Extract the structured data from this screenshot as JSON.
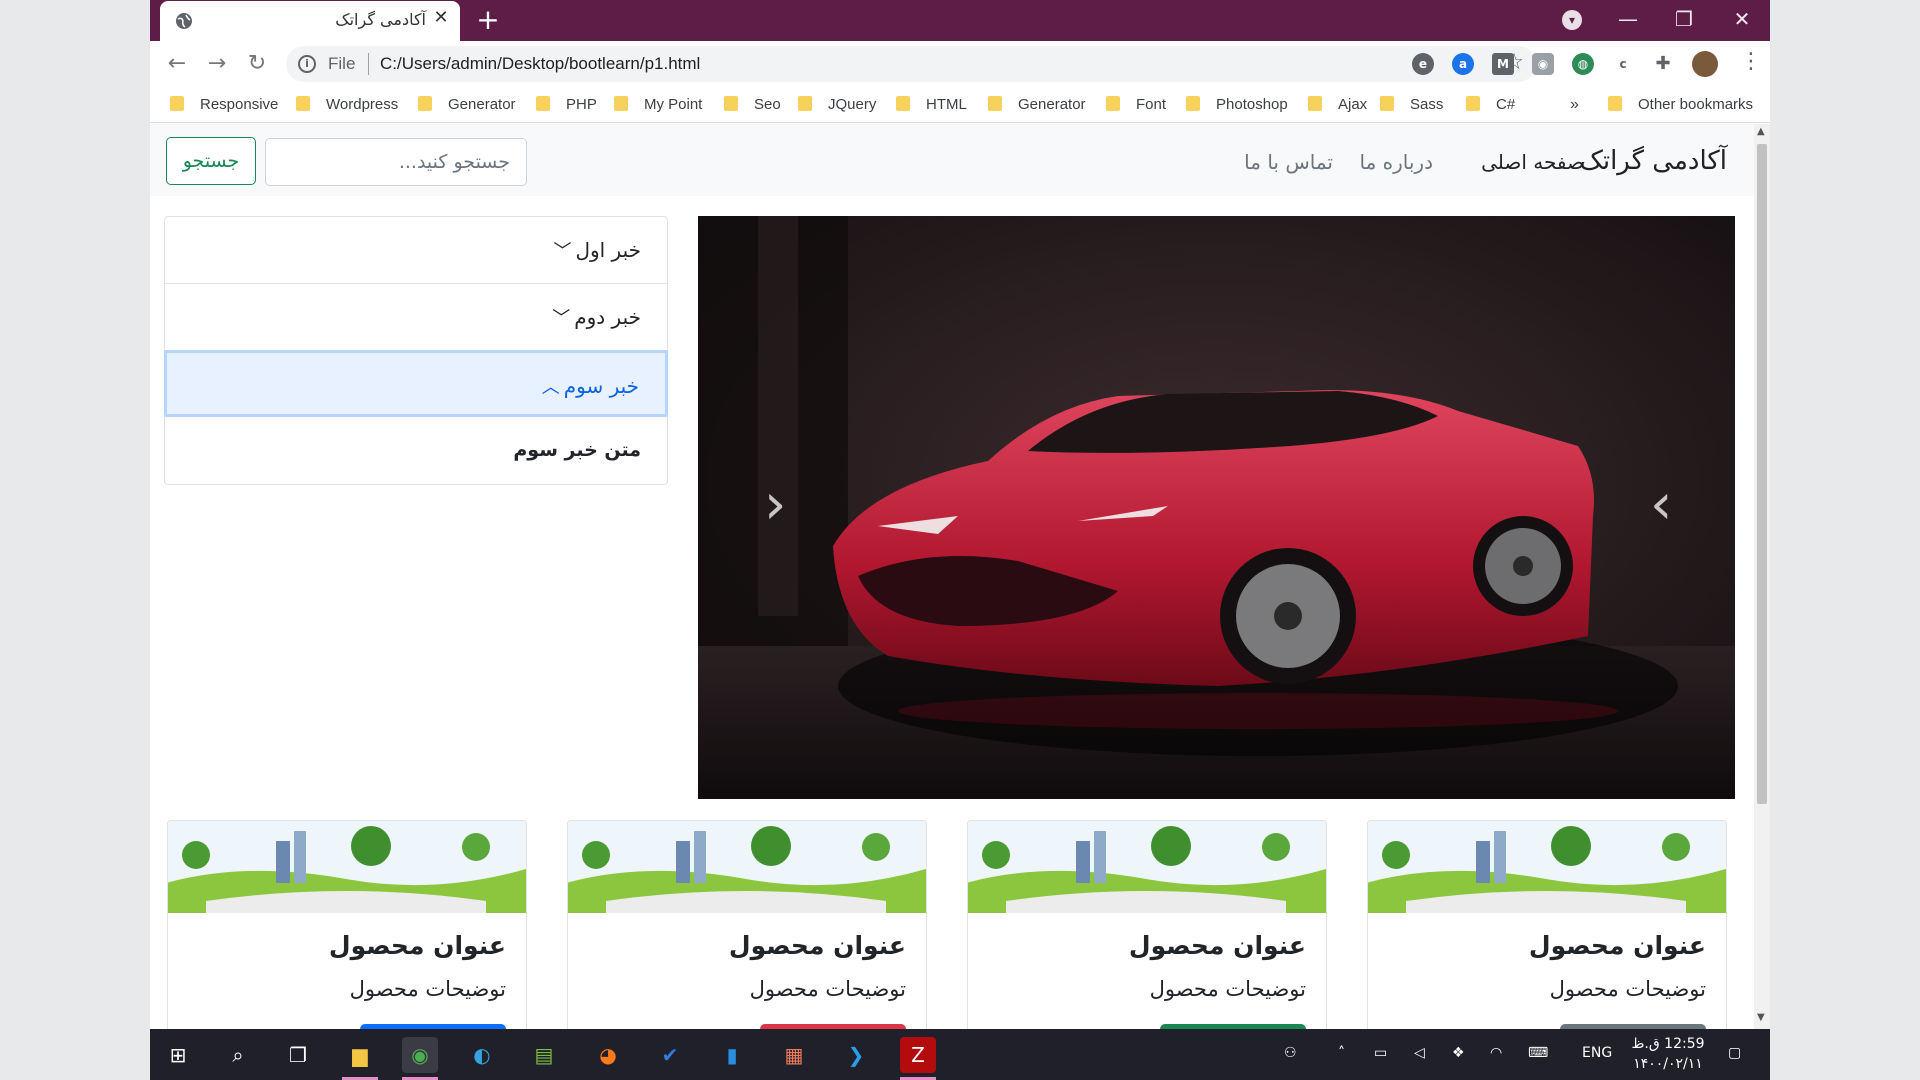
{
  "browser": {
    "tab_title": "آکادمی گراتک",
    "tab_close": "✕",
    "new_tab": "+",
    "address_scheme": "File",
    "address_url": "C:/Users/admin/Desktop/bootlearn/p1.html",
    "bookmarks": [
      "Responsive",
      "Wordpress",
      "Generator",
      "PHP",
      "My Point",
      "Seo",
      "JQuery",
      "HTML",
      "Generator",
      "Font",
      "Photoshop",
      "Ajax",
      "Sass",
      "C#"
    ],
    "bookmarks_more": "»",
    "other_bookmarks": "Other bookmarks",
    "accent": "#5e1d47"
  },
  "page": {
    "brand": "آکادمی گراتک",
    "nav": [
      "صفحه اصلی",
      "درباره ما",
      "تماس با ما"
    ],
    "search_placeholder": "جستجو کنید...",
    "search_button": "جستجو",
    "carousel_prev": "‹",
    "carousel_next": "›",
    "accordion": [
      {
        "title": "خبر اول",
        "open": false
      },
      {
        "title": "خبر دوم",
        "open": false
      },
      {
        "title": "خبر سوم",
        "open": true
      }
    ],
    "accordion_body": "متن خبر سوم",
    "cards": [
      {
        "title": "عنوان محصول",
        "text": "توضیحات محصول",
        "button_color": "#6c757d"
      },
      {
        "title": "عنوان محصول",
        "text": "توضیحات محصول",
        "button_color": "#198754"
      },
      {
        "title": "عنوان محصول",
        "text": "توضیحات محصول",
        "button_color": "#dc3545"
      },
      {
        "title": "عنوان محصول",
        "text": "توضیحات محصول",
        "button_color": "#0d6efd"
      }
    ]
  },
  "taskbar": {
    "apps": [
      "windows-start",
      "search",
      "task-view",
      "file-explorer",
      "chrome",
      "edge",
      "notepad-plus",
      "firefox",
      "todo",
      "word-file",
      "paint",
      "vscode",
      "filezilla"
    ],
    "language": "ENG",
    "time": "12:59 ق.ظ",
    "date": "۱۴۰۰/۰۲/۱۱"
  }
}
